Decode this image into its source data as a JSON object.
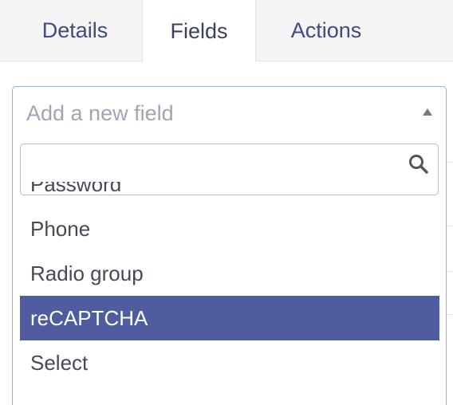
{
  "tabs": [
    {
      "label": "Details"
    },
    {
      "label": "Fields"
    },
    {
      "label": "Actions"
    }
  ],
  "add_field_select": {
    "placeholder": "Add a new field",
    "search_value": "",
    "options": [
      {
        "label": "Password"
      },
      {
        "label": "Phone"
      },
      {
        "label": "Radio group"
      },
      {
        "label": "reCAPTCHA",
        "highlighted": true
      },
      {
        "label": "Select"
      }
    ]
  },
  "colors": {
    "highlight": "#505ca0",
    "tab_text": "#3f4a80",
    "focus_border": "#9aaed6"
  }
}
